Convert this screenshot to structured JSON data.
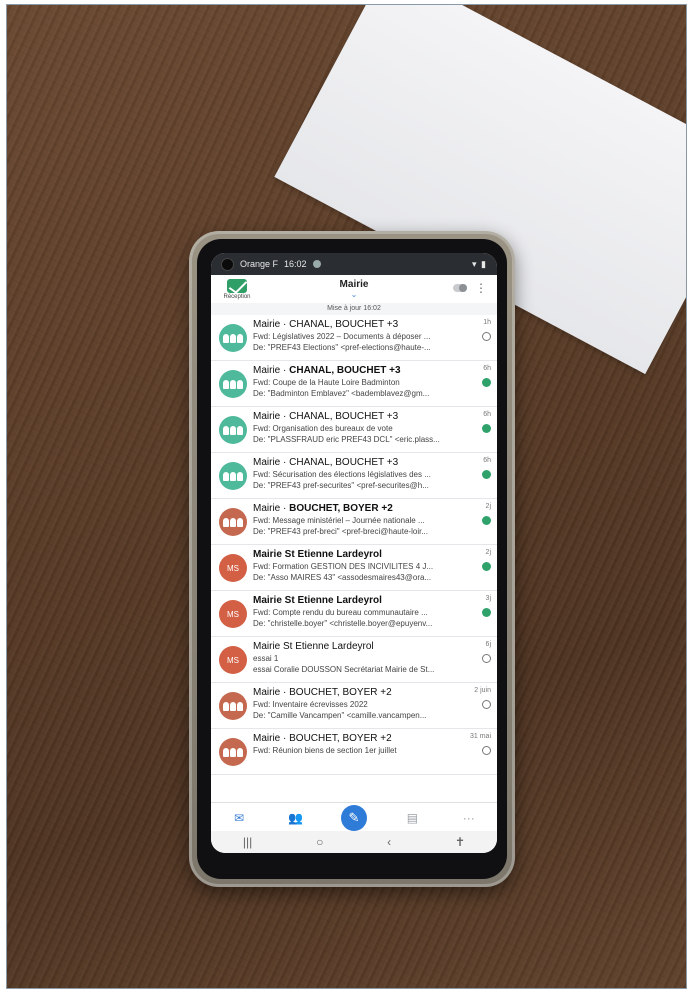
{
  "status_bar": {
    "carrier": "Orange F",
    "time": "16:02"
  },
  "app_bar": {
    "inbox_label": "Réception",
    "title": "Mairie",
    "updated": "Mise à jour 16:02"
  },
  "messages": [
    {
      "from_prefix": "Mairie ·",
      "from": "CHANAL, BOUCHET +3",
      "bold": false,
      "subject": "Fwd: Législatives 2022 – Documents à déposer ...",
      "preview": "De: \"PREF43 Elections\" <pref-elections@haute-...",
      "time": "1h",
      "status": "read",
      "avatar": "group-teal"
    },
    {
      "from_prefix": "Mairie ·",
      "from": "CHANAL, BOUCHET +3",
      "bold": true,
      "subject": "Fwd: Coupe de la Haute Loire Badminton",
      "preview": "De: \"Badminton Emblavez\" <bademblavez@gm...",
      "time": "6h",
      "status": "unread",
      "avatar": "group-teal"
    },
    {
      "from_prefix": "Mairie ·",
      "from": "CHANAL, BOUCHET +3",
      "bold": false,
      "subject": "Fwd: Organisation des bureaux de vote",
      "preview": "De: \"PLASSFRAUD eric PREF43 DCL\" <eric.plass...",
      "time": "6h",
      "status": "unread",
      "avatar": "group-teal"
    },
    {
      "from_prefix": "Mairie ·",
      "from": "CHANAL, BOUCHET +3",
      "bold": false,
      "subject": "Fwd: Sécurisation des élections législatives des ...",
      "preview": "De: \"PREF43 pref-securites\" <pref-securites@h...",
      "time": "6h",
      "status": "unread",
      "avatar": "group-teal"
    },
    {
      "from_prefix": "Mairie ·",
      "from": "BOUCHET, BOYER +2",
      "bold": true,
      "subject": "Fwd: Message ministériel – Journée nationale ...",
      "preview": "De: \"PREF43 pref-breci\" <pref-breci@haute-loir...",
      "time": "2j",
      "status": "unread",
      "avatar": "group-brown"
    },
    {
      "from_prefix": "",
      "from": "Mairie St Etienne Lardeyrol",
      "bold": true,
      "subject": "Fwd: Formation GESTION DES INCIVILITES 4 J...",
      "preview": "De: \"Asso MAIRES 43\" <assodesmaires43@ora...",
      "time": "2j",
      "status": "unread",
      "avatar": "initials",
      "initials": "MS"
    },
    {
      "from_prefix": "",
      "from": "Mairie St Etienne Lardeyrol",
      "bold": true,
      "subject": "Fwd: Compte rendu du bureau communautaire ...",
      "preview": "De: \"christelle.boyer\" <christelle.boyer@epuyenv...",
      "time": "3j",
      "status": "unread",
      "avatar": "initials",
      "initials": "MS"
    },
    {
      "from_prefix": "",
      "from": "Mairie St Etienne Lardeyrol",
      "bold": false,
      "subject": "essai 1",
      "preview": "essai Coralie DOUSSON Secrétariat Mairie de St...",
      "time": "6j",
      "status": "read",
      "avatar": "initials",
      "initials": "MS"
    },
    {
      "from_prefix": "Mairie ·",
      "from": "BOUCHET, BOYER +2",
      "bold": false,
      "subject": "Fwd: Inventaire écrevisses 2022",
      "preview": "De: \"Camille Vancampen\" <camille.vancampen...",
      "time": "2 juin",
      "status": "read",
      "avatar": "group-brown"
    },
    {
      "from_prefix": "Mairie ·",
      "from": "BOUCHET, BOYER +2",
      "bold": false,
      "subject": "Fwd: Réunion biens de section 1er juillet",
      "preview": "",
      "time": "31 mai",
      "status": "read",
      "avatar": "group-brown"
    }
  ],
  "tabs": {
    "mail_icon": "envelope-icon",
    "contacts_icon": "people-icon",
    "compose_icon": "compose-icon",
    "tasks_icon": "clipboard-icon",
    "more_icon": "more-icon"
  },
  "colors": {
    "accent": "#2f7bd8",
    "unread_dot": "#2fa26b",
    "avatar_teal": "#4fb99b",
    "avatar_initials": "#d35f44"
  }
}
